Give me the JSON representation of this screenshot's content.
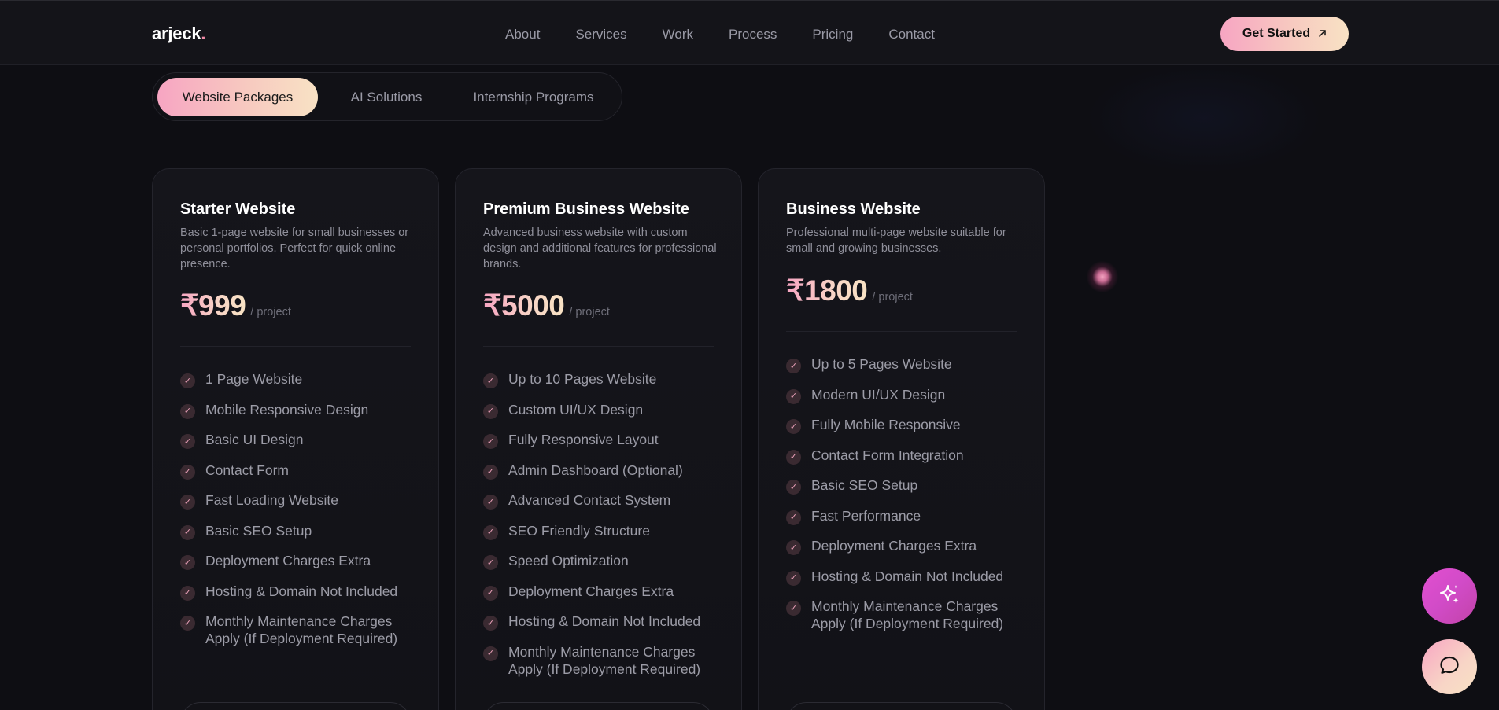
{
  "nav": {
    "logo_text": "arjeck",
    "logo_dot": ".",
    "links": [
      "About",
      "Services",
      "Work",
      "Process",
      "Pricing",
      "Contact"
    ],
    "cta_label": "Get Started",
    "cta_icon": "arrow-up-right-icon"
  },
  "tabs": [
    {
      "label": "Website Packages",
      "active": true
    },
    {
      "label": "AI Solutions",
      "active": false
    },
    {
      "label": "Internship Programs",
      "active": false
    }
  ],
  "cards": [
    {
      "title": "Starter Website",
      "description": "Basic 1-page website for small businesses or personal portfolios. Perfect for quick online presence.",
      "price": "₹999",
      "unit": "/ project",
      "features": [
        "1 Page Website",
        "Mobile Responsive Design",
        "Basic UI Design",
        "Contact Form",
        "Fast Loading Website",
        "Basic SEO Setup",
        "Deployment Charges Extra",
        "Hosting & Domain Not Included",
        "Monthly Maintenance Charges Apply (If Deployment Required)"
      ]
    },
    {
      "title": "Premium Business Website",
      "description": "Advanced business website with custom design and additional features for professional brands.",
      "price": "₹5000",
      "unit": "/ project",
      "features": [
        "Up to 10 Pages Website",
        "Custom UI/UX Design",
        "Fully Responsive Layout",
        "Admin Dashboard (Optional)",
        "Advanced Contact System",
        "SEO Friendly Structure",
        "Speed Optimization",
        "Deployment Charges Extra",
        "Hosting & Domain Not Included",
        "Monthly Maintenance Charges Apply (If Deployment Required)"
      ]
    },
    {
      "title": "Business Website",
      "description": "Professional multi-page website suitable for small and growing businesses.",
      "price": "₹1800",
      "unit": "/ project",
      "features": [
        "Up to 5 Pages Website",
        "Modern UI/UX Design",
        "Fully Mobile Responsive",
        "Contact Form Integration",
        "Basic SEO Setup",
        "Fast Performance",
        "Deployment Charges Extra",
        "Hosting & Domain Not Included",
        "Monthly Maintenance Charges Apply (If Deployment Required)"
      ]
    }
  ],
  "floating": {
    "ai_icon": "sparkles-icon",
    "chat_icon": "chat-bubble-icon"
  },
  "colors": {
    "accent_pink": "#f7a5c2",
    "accent_peach": "#f8e2c4",
    "fab_magenta": "#d14bc7",
    "background": "#0e0e13"
  }
}
